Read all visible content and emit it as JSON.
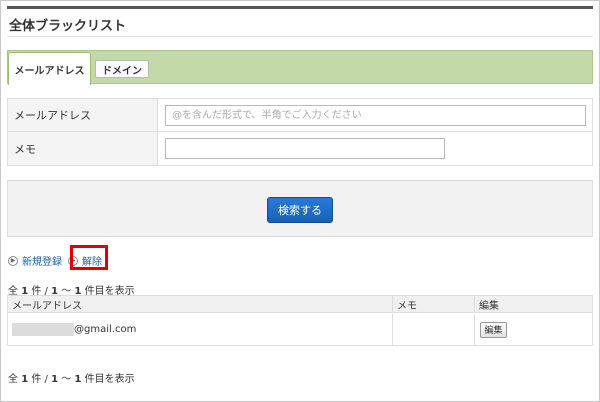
{
  "page": {
    "title": "全体ブラックリスト"
  },
  "tabs": [
    {
      "label": "メールアドレス",
      "active": true
    },
    {
      "label": "ドメイン",
      "active": false
    }
  ],
  "form": {
    "email_label": "メールアドレス",
    "email_placeholder": "@を含んだ形式で、半角でご入力ください",
    "email_value": "",
    "memo_label": "メモ",
    "memo_value": ""
  },
  "search": {
    "button_label": "検索する"
  },
  "actions": {
    "new_label": "新規登録",
    "remove_label": "解除"
  },
  "pagination": {
    "prefix": "全",
    "total": "1",
    "mid": "件 /",
    "from": "1",
    "sep": "～",
    "to": "1",
    "suffix": "件目を表示"
  },
  "table": {
    "headers": [
      "メールアドレス",
      "メモ",
      "編集"
    ],
    "rows": [
      {
        "email_suffix": "@gmail.com",
        "memo": "",
        "edit_label": "編集"
      }
    ]
  },
  "colors": {
    "tab_bar": "#c3d9a8",
    "search_button": "#1a6cc8",
    "highlight": "#e00000",
    "link": "#1a5fa8"
  }
}
